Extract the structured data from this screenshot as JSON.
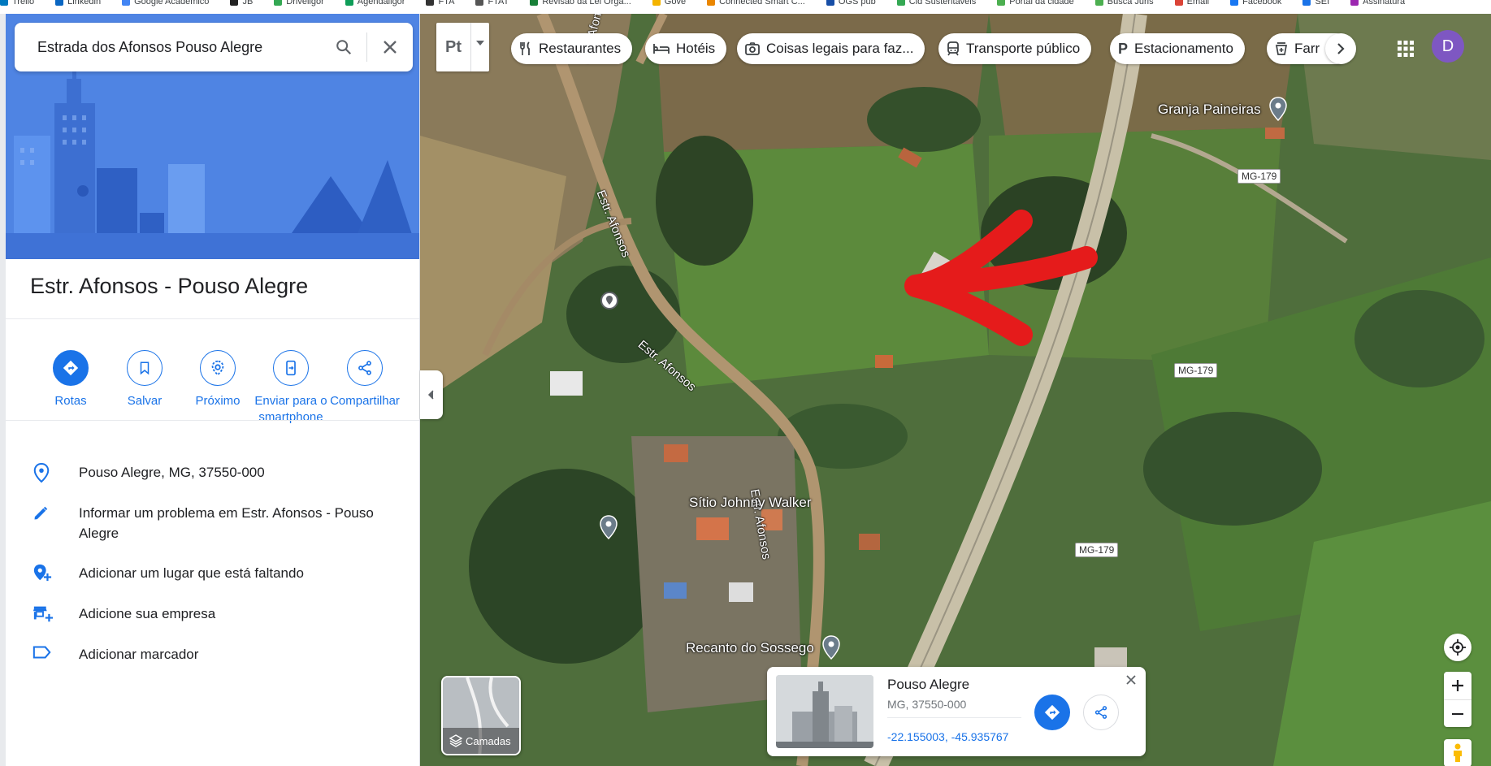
{
  "bookmarks": [
    "Trello",
    "Linkedin",
    "Google Acadêmico",
    "JB",
    "Driveligor",
    "Agendaligor",
    "FTA",
    "FTAT",
    "Revisão da Lei Orgâ...",
    "Gove",
    "Connected Smart C...",
    "OGS pub",
    "Cid Sustentáveis",
    "Portal da cidade",
    "Busca Juris",
    "Email",
    "Facebook",
    "SEI",
    "Assinatura"
  ],
  "search": {
    "value": "Estrada dos Afonsos Pouso Alegre"
  },
  "place": {
    "title": "Estr. Afonsos - Pouso Alegre"
  },
  "actions": {
    "routes": "Rotas",
    "save": "Salvar",
    "nearby": "Próximo",
    "send": "Enviar para o smartphone",
    "share": "Compartilhar"
  },
  "details": {
    "address": "Pouso Alegre, MG, 37550-000",
    "report": "Informar um problema em Estr. Afonsos - Pouso Alegre",
    "add_place": "Adicionar um lugar que está faltando",
    "add_business": "Adicione sua empresa",
    "add_label": "Adicionar marcador"
  },
  "map": {
    "mode_label": "Pt",
    "chips": [
      "Restaurantes",
      "Hotéis",
      "Coisas legais para faz...",
      "Transporte público",
      "Estacionamento",
      "Farr"
    ],
    "avatar_letter": "D",
    "labels": {
      "granja": "Granja Paineiras",
      "sitio": "Sítio Johnny Walker",
      "recanto": "Recanto do Sossego"
    },
    "road_signs": [
      "MG-179",
      "MG-179",
      "MG-179"
    ],
    "road_names": [
      "Estr. Afonsos",
      "Estr. Afonsos",
      "Estr. Afonsos",
      "Estr. Afonsos"
    ],
    "layers_label": "Camadas"
  },
  "card": {
    "title": "Pouso Alegre",
    "subtitle": "MG, 37550-000",
    "coords": "-22.155003, -45.935767"
  },
  "colors": {
    "accent": "#1a73e8",
    "hero": "#4f84e3",
    "arrow": "#e51b1b",
    "avatar": "#7e57c2"
  }
}
